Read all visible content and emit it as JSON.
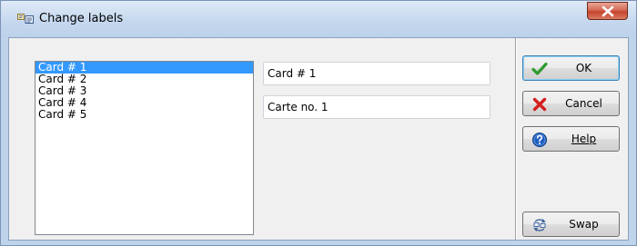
{
  "window": {
    "title": "Change labels"
  },
  "list": {
    "items": [
      "Card # 1",
      "Card # 2",
      "Card # 3",
      "Card # 4",
      "Card # 5"
    ],
    "selected_index": 0
  },
  "fields": {
    "label_primary": "Card # 1",
    "label_secondary": "Carte no. 1"
  },
  "buttons": {
    "ok": {
      "label": "OK",
      "icon": "checkmark-icon"
    },
    "cancel": {
      "label": "Cancel",
      "icon": "x-icon"
    },
    "help": {
      "label": "Help",
      "icon": "help-icon"
    },
    "swap": {
      "label": "Swap",
      "icon": "swap-icon"
    }
  },
  "colors": {
    "selection": "#3399ff",
    "ok_check": "#2e9a2e",
    "cancel_x": "#d42020",
    "help_blue": "#1f5fbf",
    "close_red": "#c6442c"
  }
}
